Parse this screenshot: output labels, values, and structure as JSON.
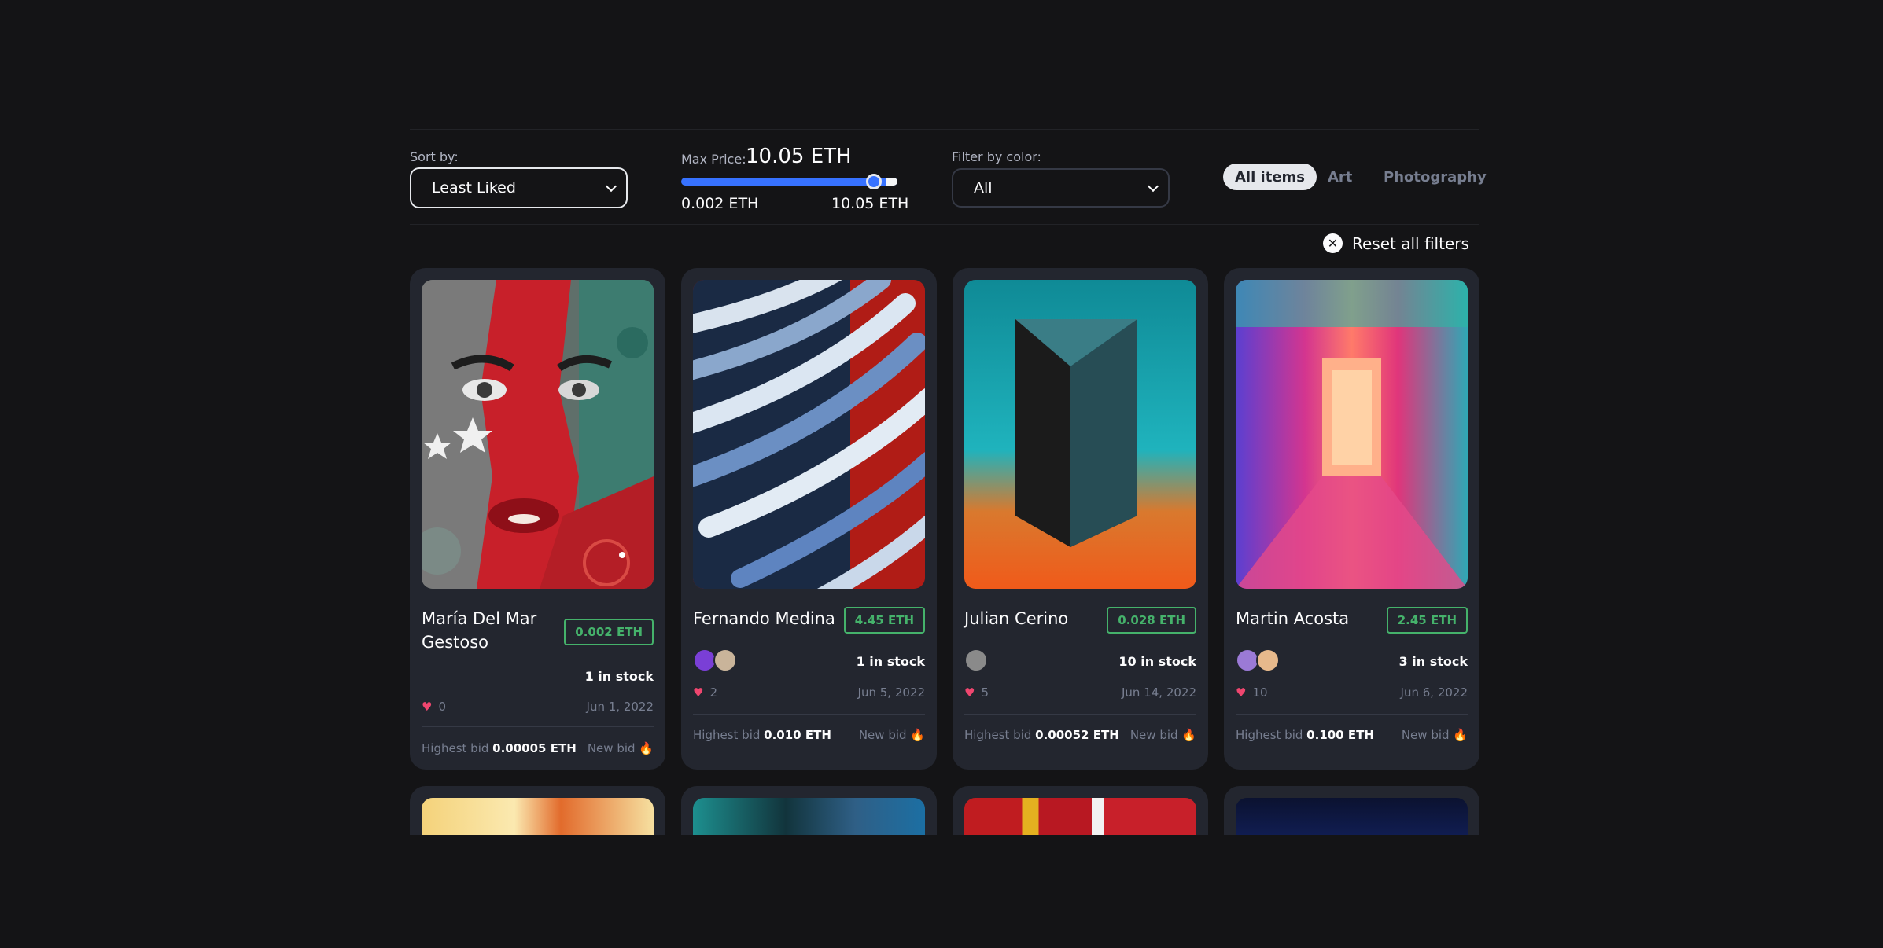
{
  "filters": {
    "sort_label": "Sort by:",
    "sort_value": "Least Liked",
    "max_price_label": "Max Price:",
    "max_price_value": "10.05 ETH",
    "max_price_fraction": 0.89,
    "range_min": "0.002 ETH",
    "range_max": "10.05 ETH",
    "color_label": "Filter by color:",
    "color_value": "All",
    "accent_color": "#3772ff"
  },
  "tabs": [
    {
      "label": "All items",
      "active": true
    },
    {
      "label": "Art",
      "active": false
    },
    {
      "label": "Photography",
      "active": false
    }
  ],
  "reset_label": "Reset all filters",
  "cards": [
    {
      "name": "María Del Mar Gestoso",
      "price": "0.002 ETH",
      "stock": "1 in stock",
      "likes": "0",
      "date": "Jun 1, 2022",
      "bid_label": "Highest bid",
      "bid_value": "0.00005 ETH",
      "new_bid": "New bid"
    },
    {
      "name": "Fernando Medina",
      "price": "4.45 ETH",
      "stock": "1 in stock",
      "likes": "2",
      "date": "Jun 5, 2022",
      "bid_label": "Highest bid",
      "bid_value": "0.010 ETH",
      "new_bid": "New bid"
    },
    {
      "name": "Julian Cerino",
      "price": "0.028 ETH",
      "stock": "10 in stock",
      "likes": "5",
      "date": "Jun 14, 2022",
      "bid_label": "Highest bid",
      "bid_value": "0.00052 ETH",
      "new_bid": "New bid"
    },
    {
      "name": "Martin Acosta",
      "price": "2.45 ETH",
      "stock": "3 in stock",
      "likes": "10",
      "date": "Jun 6, 2022",
      "bid_label": "Highest bid",
      "bid_value": "0.100 ETH",
      "new_bid": "New bid"
    }
  ],
  "icons": {
    "heart": "heart-icon",
    "fire": "fire-icon",
    "close": "close-circle-icon",
    "chevron": "chevron-down-icon"
  },
  "colors": {
    "price_badge": "#45b26b",
    "heart": "#ef466f",
    "background": "#141416",
    "card": "#23262f"
  }
}
